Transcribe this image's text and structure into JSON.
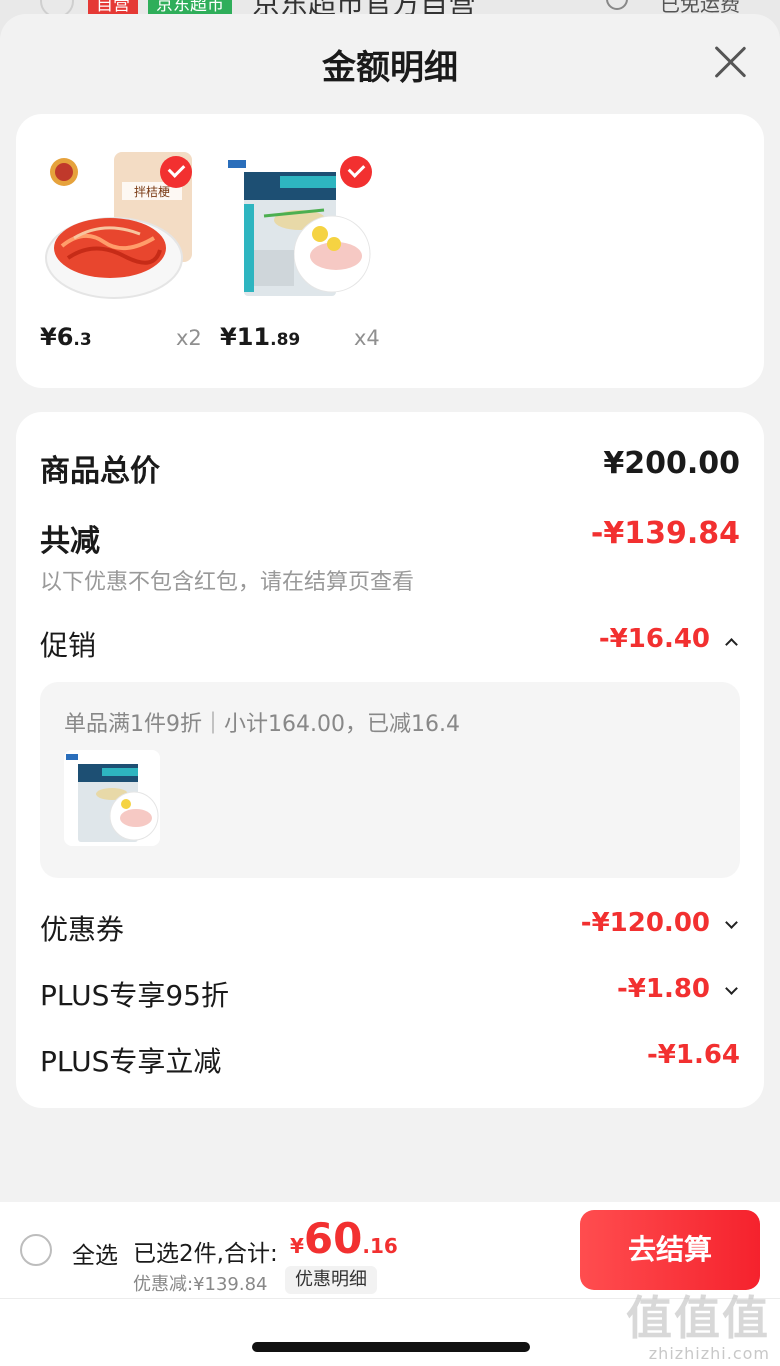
{
  "peek": {
    "badge_self": "自营",
    "badge_market": "京东超市",
    "store_name": "京东超市官方自营",
    "shipping": "已免运费"
  },
  "sheet": {
    "title": "金额明细"
  },
  "products": [
    {
      "price_int": "¥6",
      "price_dec": ".3",
      "qty": "x2",
      "checked": true
    },
    {
      "price_int": "¥11",
      "price_dec": ".89",
      "qty": "x4",
      "checked": true
    }
  ],
  "summary": {
    "total_label": "商品总价",
    "total_value": "¥200.00",
    "reduce_label": "共减",
    "reduce_value": "-¥139.84",
    "note": "以下优惠不包含红包，请在结算页查看",
    "promo_label": "促销",
    "promo_value": "-¥16.40",
    "promo_desc": "单品满1件9折｜小计164.00，已减16.4",
    "coupon_label": "优惠券",
    "coupon_value": "-¥120.00",
    "plus95_label": "PLUS专享95折",
    "plus95_value": "-¥1.80",
    "plusreduce_label": "PLUS专享立减",
    "plusreduce_value": "-¥1.64"
  },
  "bottom": {
    "select_all": "全选",
    "selected_text": "已选2件,合计:",
    "total_yen": "¥",
    "total_int": "60",
    "total_dec": ".16",
    "discount_line": "优惠减:¥139.84",
    "detail_button": "优惠明细",
    "checkout": "去结算"
  },
  "watermark": {
    "big": "值值值",
    "small": "zhizhizhi.com"
  },
  "colors": {
    "accent": "#f23030",
    "background": "#f2f2f2",
    "card": "#ffffff"
  }
}
